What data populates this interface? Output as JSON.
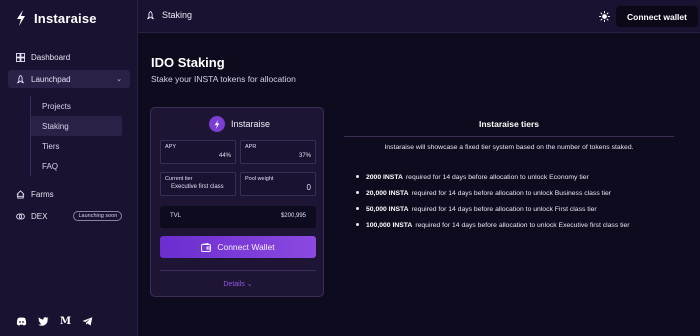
{
  "brand": {
    "name": "Instaraise"
  },
  "sidebar": {
    "items": [
      {
        "label": "Dashboard"
      },
      {
        "label": "Launchpad"
      },
      {
        "label": "Farms"
      },
      {
        "label": "DEX",
        "badge": "Launching soon"
      }
    ],
    "launchpad_sub": [
      {
        "label": "Projects"
      },
      {
        "label": "Staking"
      },
      {
        "label": "Tiers"
      },
      {
        "label": "FAQ"
      }
    ],
    "socials": [
      "discord-icon",
      "twitter-icon",
      "medium-icon",
      "telegram-icon"
    ]
  },
  "topbar": {
    "breadcrumb": "Staking",
    "connect_label": "Connect wallet"
  },
  "page": {
    "title": "IDO Staking",
    "subtitle": "Stake your INSTA tokens for allocation"
  },
  "card": {
    "name": "Instaraise",
    "apy_label": "APY",
    "apy_value": "44%",
    "apr_label": "APR",
    "apr_value": "37%",
    "tier_label": "Current tier",
    "tier_value": "Executive first class",
    "pool_label": "Pool weight",
    "pool_value": "0",
    "tvl_label": "TVL",
    "tvl_value": "$200,995",
    "connect_label": "Connect Wallet",
    "details_label": "Details"
  },
  "panel": {
    "title": "Instaraise tiers",
    "description": "Instaraise will showcase a fixed tier system based on the number of tokens staked.",
    "tiers": [
      {
        "amount": "2000 INSTA",
        "text": "required for 14 days before allocation to unlock Economy tier"
      },
      {
        "amount": "20,000 INSTA",
        "text": "required for 14 days before allocation to unlock Business class tier"
      },
      {
        "amount": "50,000 INSTA",
        "text": "required for 14 days before allocation to unlock First class tier"
      },
      {
        "amount": "100,000 INSTA",
        "text": "required for 14 days before allocation to unlock Executive first class tier"
      }
    ]
  },
  "colors": {
    "accent": "#7a3fd2",
    "background": "#0f0b1e",
    "sidebar": "#1a1231"
  }
}
